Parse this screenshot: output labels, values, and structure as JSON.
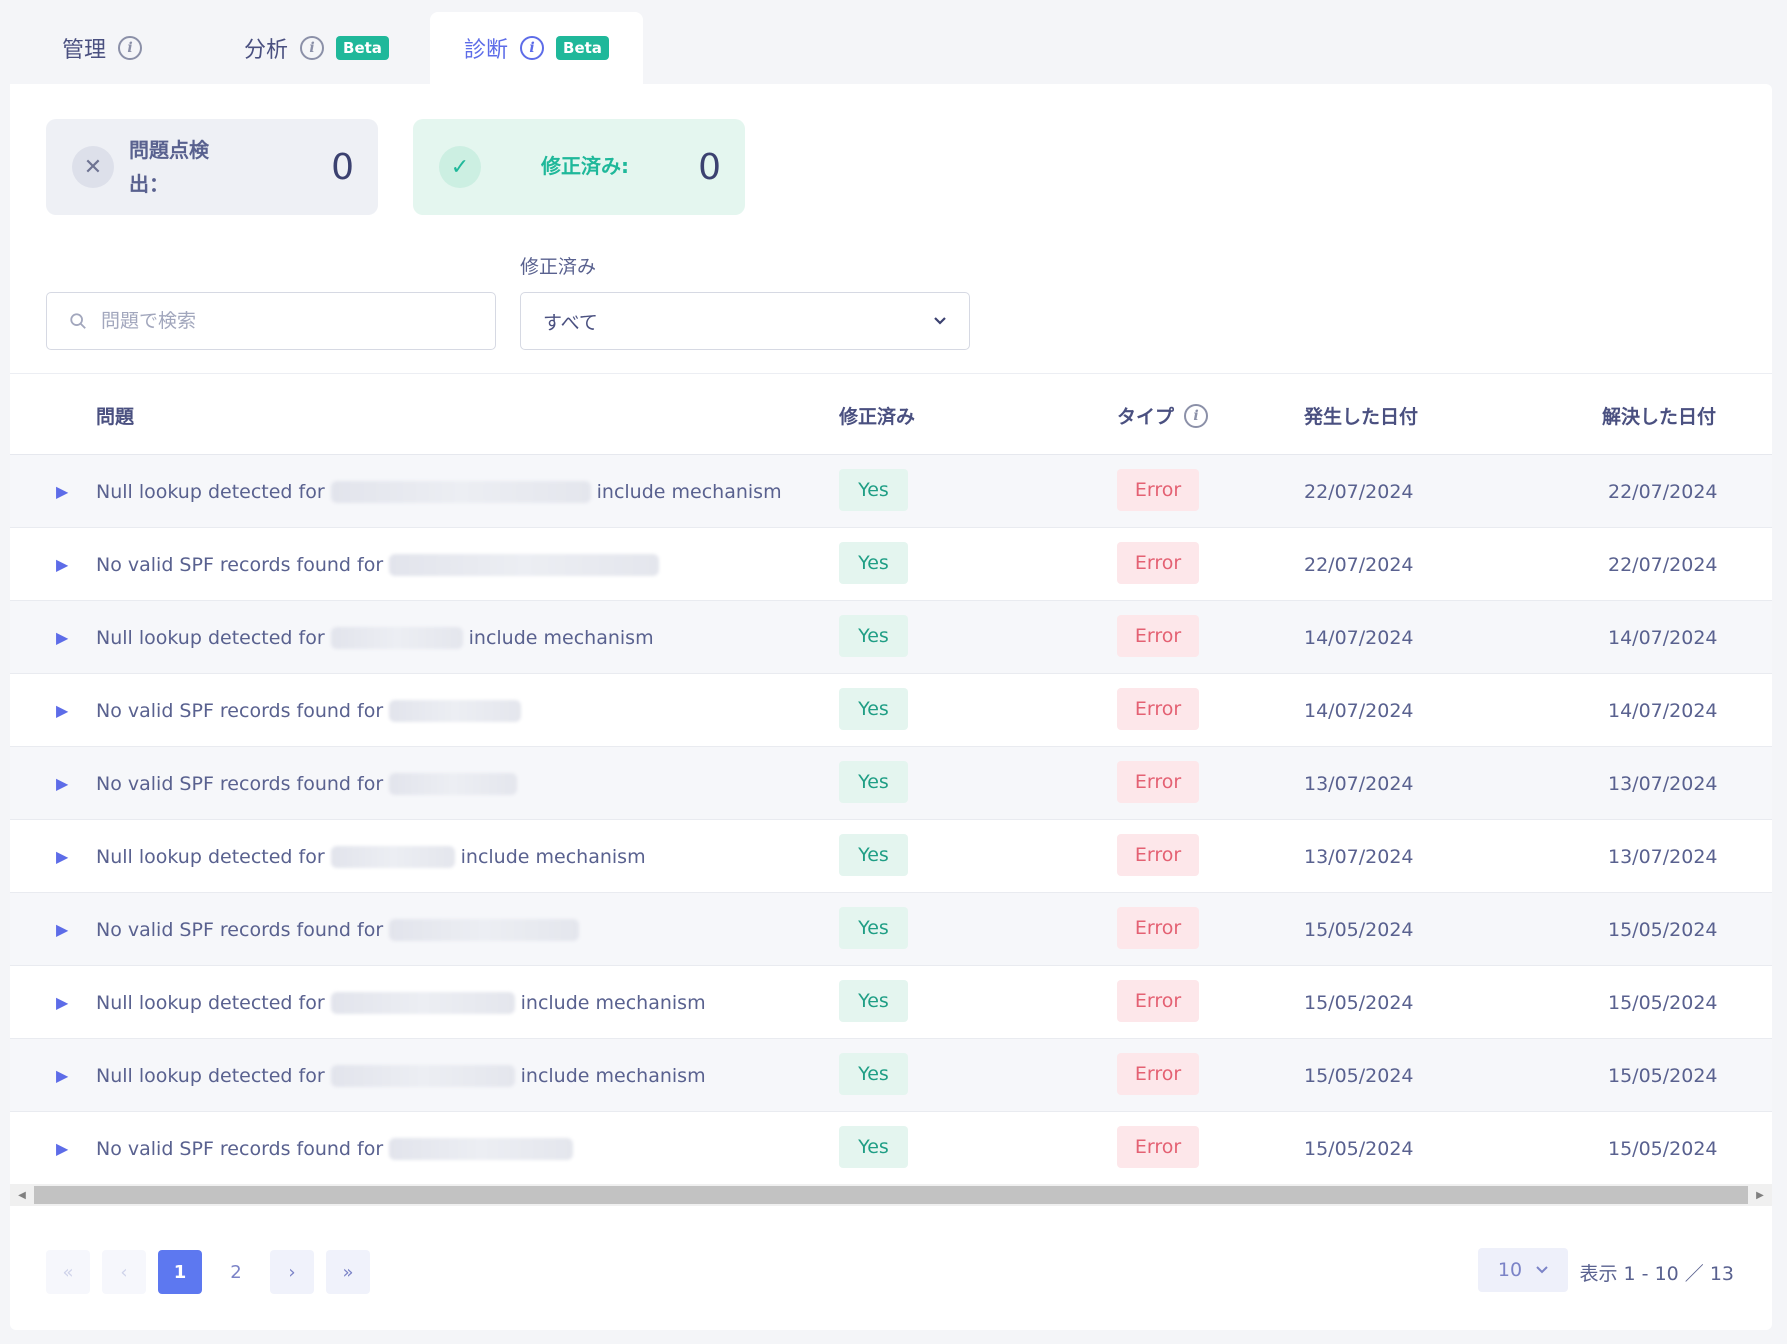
{
  "tabs": [
    {
      "label": "管理",
      "beta": ""
    },
    {
      "label": "分析",
      "beta": "Beta"
    },
    {
      "label": "診断",
      "beta": "Beta"
    }
  ],
  "cards": {
    "issues_label": "問題点検出：",
    "issues_count": "0",
    "fixed_label": "修正済み:",
    "fixed_count": "0"
  },
  "filters": {
    "search_placeholder": "問題で検索",
    "fixed_filter_label": "修正済み",
    "fixed_filter_value": "すべて"
  },
  "table": {
    "headers": {
      "issue": "問題",
      "fixed": "修正済み",
      "type": "タイプ",
      "occurred": "発生した日付",
      "resolved": "解決した日付"
    },
    "rows": [
      {
        "prefix": "Null lookup detected for",
        "suffix": "include mechanism",
        "fixed": "Yes",
        "type": "Error",
        "occurred": "22/07/2024",
        "resolved": "22/07/2024"
      },
      {
        "prefix": "No valid SPF records found for",
        "suffix": "",
        "fixed": "Yes",
        "type": "Error",
        "occurred": "22/07/2024",
        "resolved": "22/07/2024"
      },
      {
        "prefix": "Null lookup detected for",
        "suffix": "include mechanism",
        "fixed": "Yes",
        "type": "Error",
        "occurred": "14/07/2024",
        "resolved": "14/07/2024"
      },
      {
        "prefix": "No valid SPF records found for",
        "suffix": "",
        "fixed": "Yes",
        "type": "Error",
        "occurred": "14/07/2024",
        "resolved": "14/07/2024"
      },
      {
        "prefix": "No valid SPF records found for",
        "suffix": "",
        "fixed": "Yes",
        "type": "Error",
        "occurred": "13/07/2024",
        "resolved": "13/07/2024"
      },
      {
        "prefix": "Null lookup detected for",
        "suffix": "include mechanism",
        "fixed": "Yes",
        "type": "Error",
        "occurred": "13/07/2024",
        "resolved": "13/07/2024"
      },
      {
        "prefix": "No valid SPF records found for",
        "suffix": "",
        "fixed": "Yes",
        "type": "Error",
        "occurred": "15/05/2024",
        "resolved": "15/05/2024"
      },
      {
        "prefix": "Null lookup detected for",
        "suffix": "include mechanism",
        "fixed": "Yes",
        "type": "Error",
        "occurred": "15/05/2024",
        "resolved": "15/05/2024"
      },
      {
        "prefix": "Null lookup detected for",
        "suffix": "include mechanism",
        "fixed": "Yes",
        "type": "Error",
        "occurred": "15/05/2024",
        "resolved": "15/05/2024"
      },
      {
        "prefix": "No valid SPF records found for",
        "suffix": "",
        "fixed": "Yes",
        "type": "Error",
        "occurred": "15/05/2024",
        "resolved": "15/05/2024"
      }
    ]
  },
  "pagination": {
    "pages": [
      "1",
      "2"
    ],
    "current": "1",
    "per_page": "10",
    "range_text": "表示 1 - 10 ／ 13"
  },
  "colors": {
    "accent": "#5d6ce8",
    "success": "#1fb89a",
    "error": "#e46173"
  }
}
